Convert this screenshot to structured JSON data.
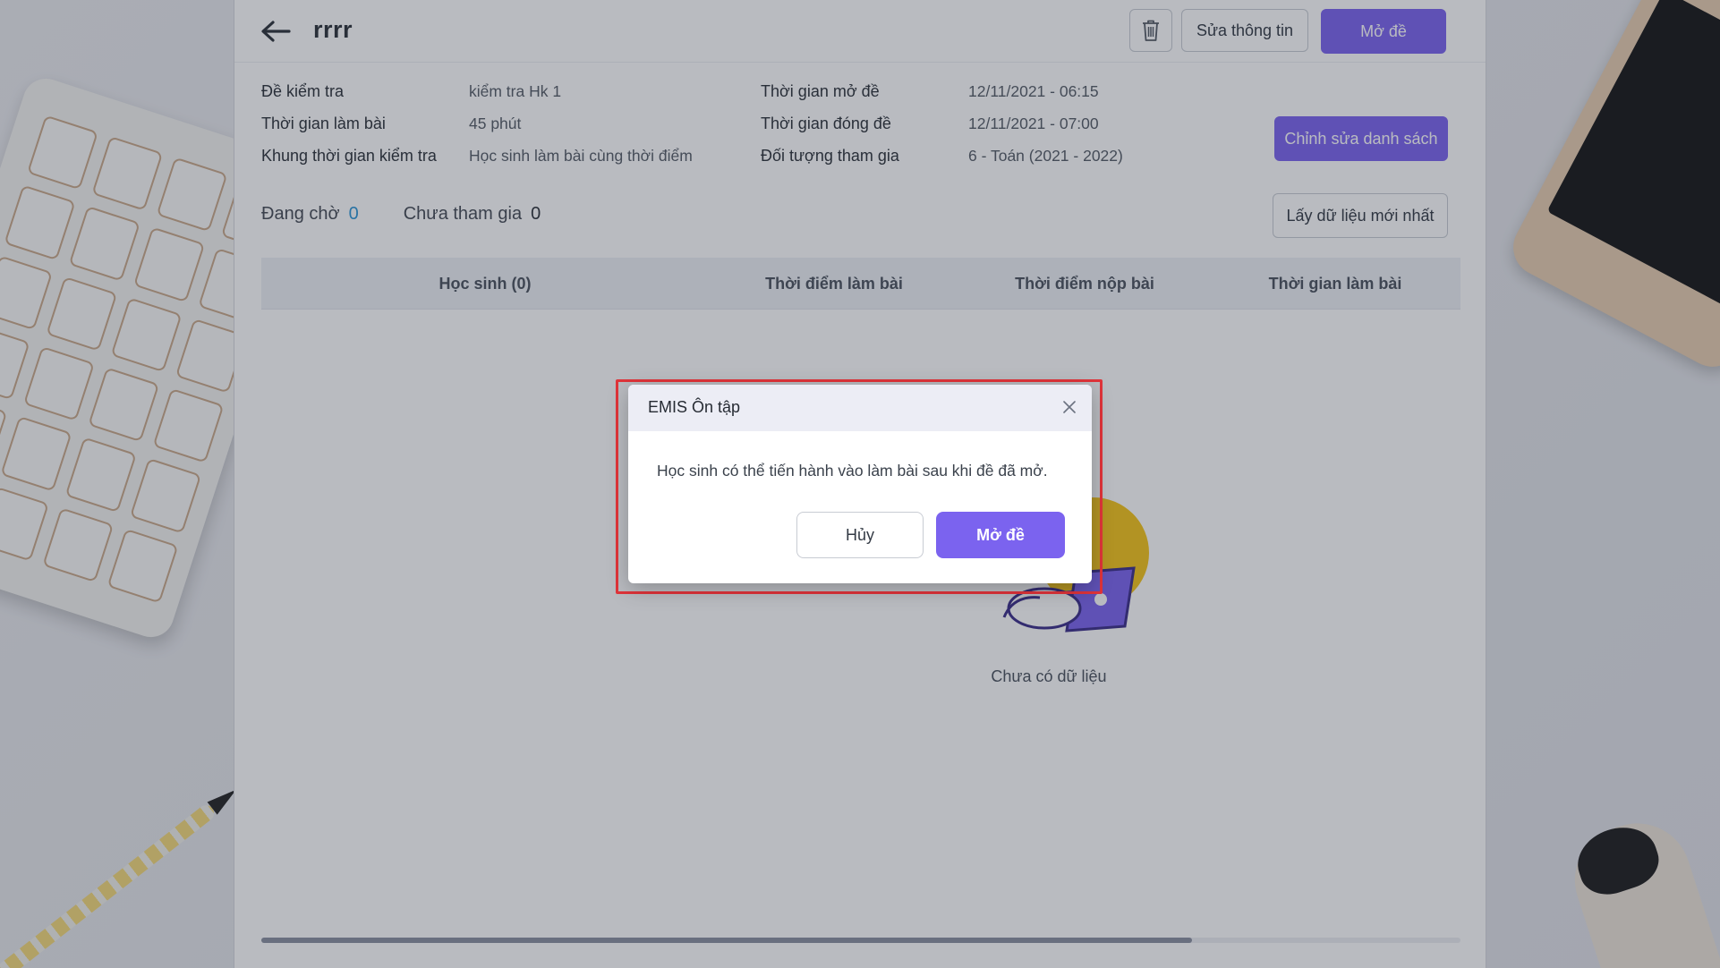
{
  "header": {
    "title": "rrrr",
    "edit_info_label": "Sửa thông tin",
    "open_exam_label": "Mở đề"
  },
  "info": {
    "left": [
      {
        "label": "Đề kiểm tra",
        "value": "kiểm tra Hk 1"
      },
      {
        "label": "Thời gian làm bài",
        "value": "45 phút"
      },
      {
        "label": "Khung thời gian kiểm tra",
        "value": "Học sinh làm bài cùng thời điểm"
      }
    ],
    "right": [
      {
        "label": "Thời gian mở đề",
        "value": "12/11/2021 - 06:15"
      },
      {
        "label": "Thời gian đóng đề",
        "value": "12/11/2021 - 07:00"
      },
      {
        "label": "Đối tượng tham gia",
        "value": "6 - Toán (2021 - 2022)"
      }
    ]
  },
  "actions": {
    "edit_list_label": "Chỉnh sửa danh sách",
    "refresh_label": "Lấy dữ liệu mới nhất"
  },
  "stats": {
    "waiting_label": "Đang chờ",
    "waiting_count": "0",
    "not_joined_label": "Chưa tham gia",
    "not_joined_count": "0"
  },
  "table": {
    "columns": [
      "Học sinh (0)",
      "Thời điểm làm bài",
      "Thời điểm nộp bài",
      "Thời gian làm bài"
    ],
    "empty_text": "Chưa có dữ liệu"
  },
  "modal": {
    "title": "EMIS Ôn tập",
    "message": "Học sinh có thể tiến hành vào làm bài sau khi đề đã mở.",
    "cancel_label": "Hủy",
    "confirm_label": "Mở đề"
  },
  "colors": {
    "primary": "#7b63ef",
    "count_blue": "#2b95d6",
    "highlight_red": "#e0343a"
  },
  "icons": [
    "arrow-left-icon",
    "trash-icon",
    "close-icon",
    "empty-illustration"
  ]
}
